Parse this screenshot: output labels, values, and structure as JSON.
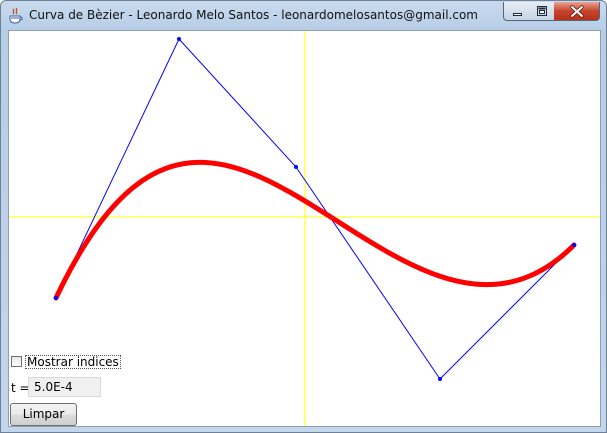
{
  "window": {
    "title": "Curva de Bèzier - Leonardo Melo Santos - leonardomelosantos@gmail.com",
    "app_icon": "java-coffee-cup-icon",
    "controls": {
      "minimize_icon": "minimize-icon",
      "maximize_icon": "maximize-icon",
      "close_icon": "close-icon"
    }
  },
  "controls": {
    "show_indices_label": "Mostrar indices",
    "show_indices_checked": false,
    "t_label": "t =",
    "t_value": "5.0E-4",
    "clear_label": "Limpar"
  },
  "colors": {
    "axis": "#ffff00",
    "control_polygon": "#0000ff",
    "control_point": "#0000ff",
    "curve": "#ff0000"
  }
}
